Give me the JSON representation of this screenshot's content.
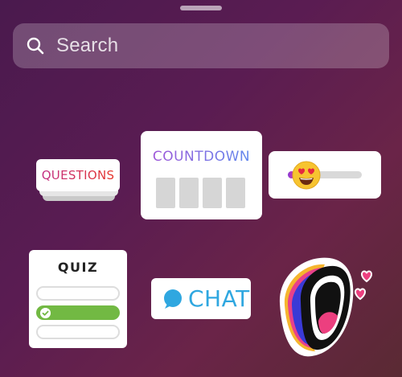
{
  "search": {
    "placeholder": "Search"
  },
  "stickers": {
    "questions": {
      "label": "QUESTIONS"
    },
    "countdown": {
      "label": "COUNTDOWN",
      "box_count": 4
    },
    "emoji_slider": {
      "emoji": "heart-eyes-emoji",
      "level": 0.1
    },
    "quiz": {
      "label": "QUIZ",
      "options_count": 3,
      "correct_option_index": 1
    },
    "chat": {
      "label": "CHAT"
    },
    "mouth": {
      "icon": "screaming-mouth-hearts-sticker"
    }
  },
  "colors": {
    "chat_blue": "#2fa7e0",
    "quiz_green": "#72b943",
    "questions_gradient": [
      "#c22f86",
      "#e6372c"
    ],
    "countdown_gradient": [
      "#a652d6",
      "#5a8ef0"
    ]
  }
}
